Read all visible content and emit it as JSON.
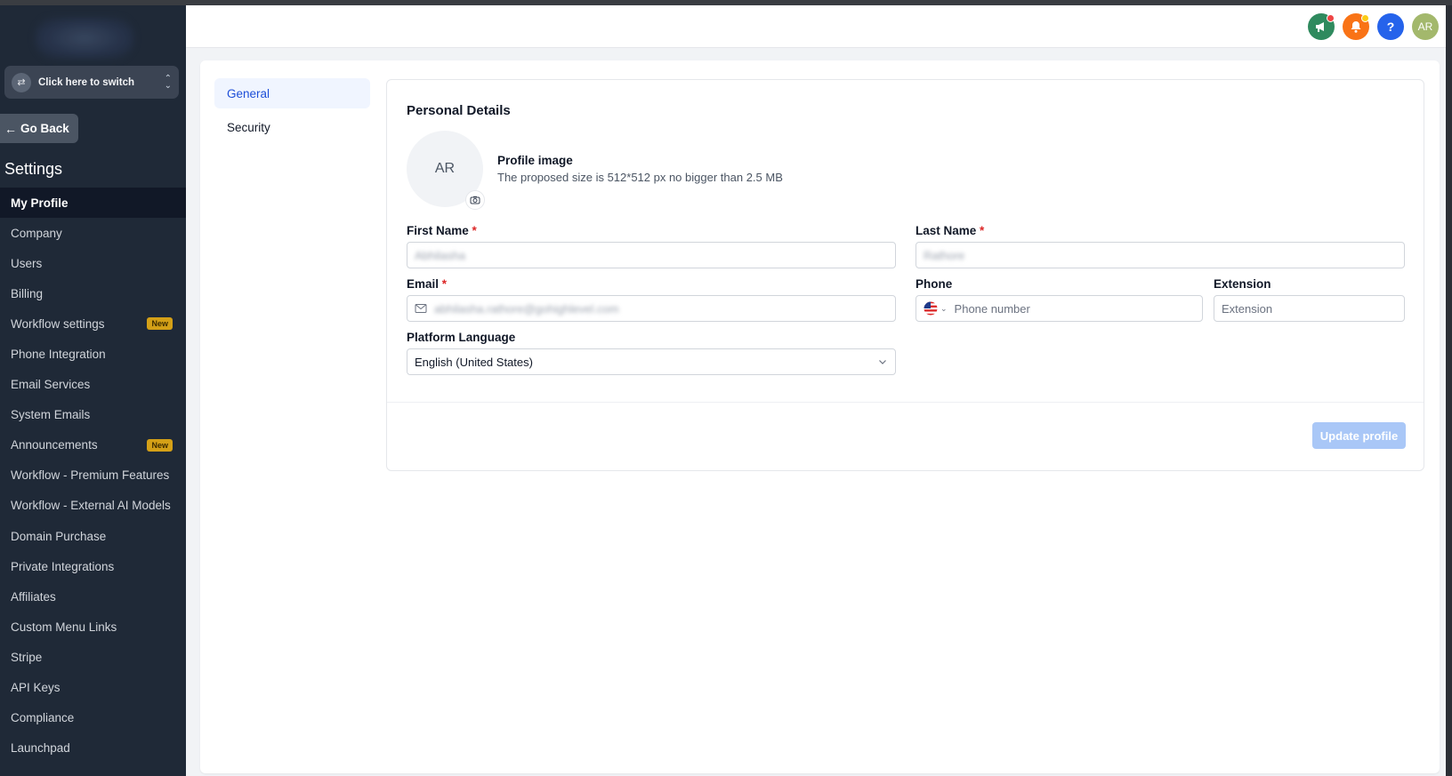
{
  "sidebar": {
    "switcher_label": "Click here to switch",
    "go_back": "Go Back",
    "title": "Settings",
    "items": [
      {
        "label": "My Profile",
        "active": true
      },
      {
        "label": "Company"
      },
      {
        "label": "Users"
      },
      {
        "label": "Billing"
      },
      {
        "label": "Workflow settings",
        "badge": "New"
      },
      {
        "label": "Phone Integration"
      },
      {
        "label": "Email Services"
      },
      {
        "label": "System Emails"
      },
      {
        "label": "Announcements",
        "badge": "New"
      },
      {
        "label": "Workflow - Premium Features"
      },
      {
        "label": "Workflow - External AI Models"
      },
      {
        "label": "Domain Purchase"
      },
      {
        "label": "Private Integrations"
      },
      {
        "label": "Affiliates"
      },
      {
        "label": "Custom Menu Links"
      },
      {
        "label": "Stripe"
      },
      {
        "label": "API Keys"
      },
      {
        "label": "Compliance"
      },
      {
        "label": "Launchpad"
      }
    ]
  },
  "header": {
    "help_label": "?",
    "avatar_initials": "AR",
    "colors": {
      "announce": "#2f8a5e",
      "bell": "#f97316",
      "help": "#2563eb",
      "avatar": "#a3b86c"
    }
  },
  "subnav": {
    "general": "General",
    "security": "Security"
  },
  "profile": {
    "section_title": "Personal Details",
    "avatar_initials": "AR",
    "image_title": "Profile image",
    "image_hint": "The proposed size is 512*512 px no bigger than 2.5 MB",
    "first_name_label": "First Name",
    "first_name_value": "Abhilasha",
    "last_name_label": "Last Name",
    "last_name_value": "Rathore",
    "email_label": "Email",
    "email_value": "abhilasha.rathore@gohighlevel.com",
    "phone_label": "Phone",
    "phone_placeholder": "Phone number",
    "extension_label": "Extension",
    "extension_placeholder": "Extension",
    "language_label": "Platform Language",
    "language_value": "English (United States)",
    "required_mark": "*",
    "update_button": "Update profile"
  }
}
